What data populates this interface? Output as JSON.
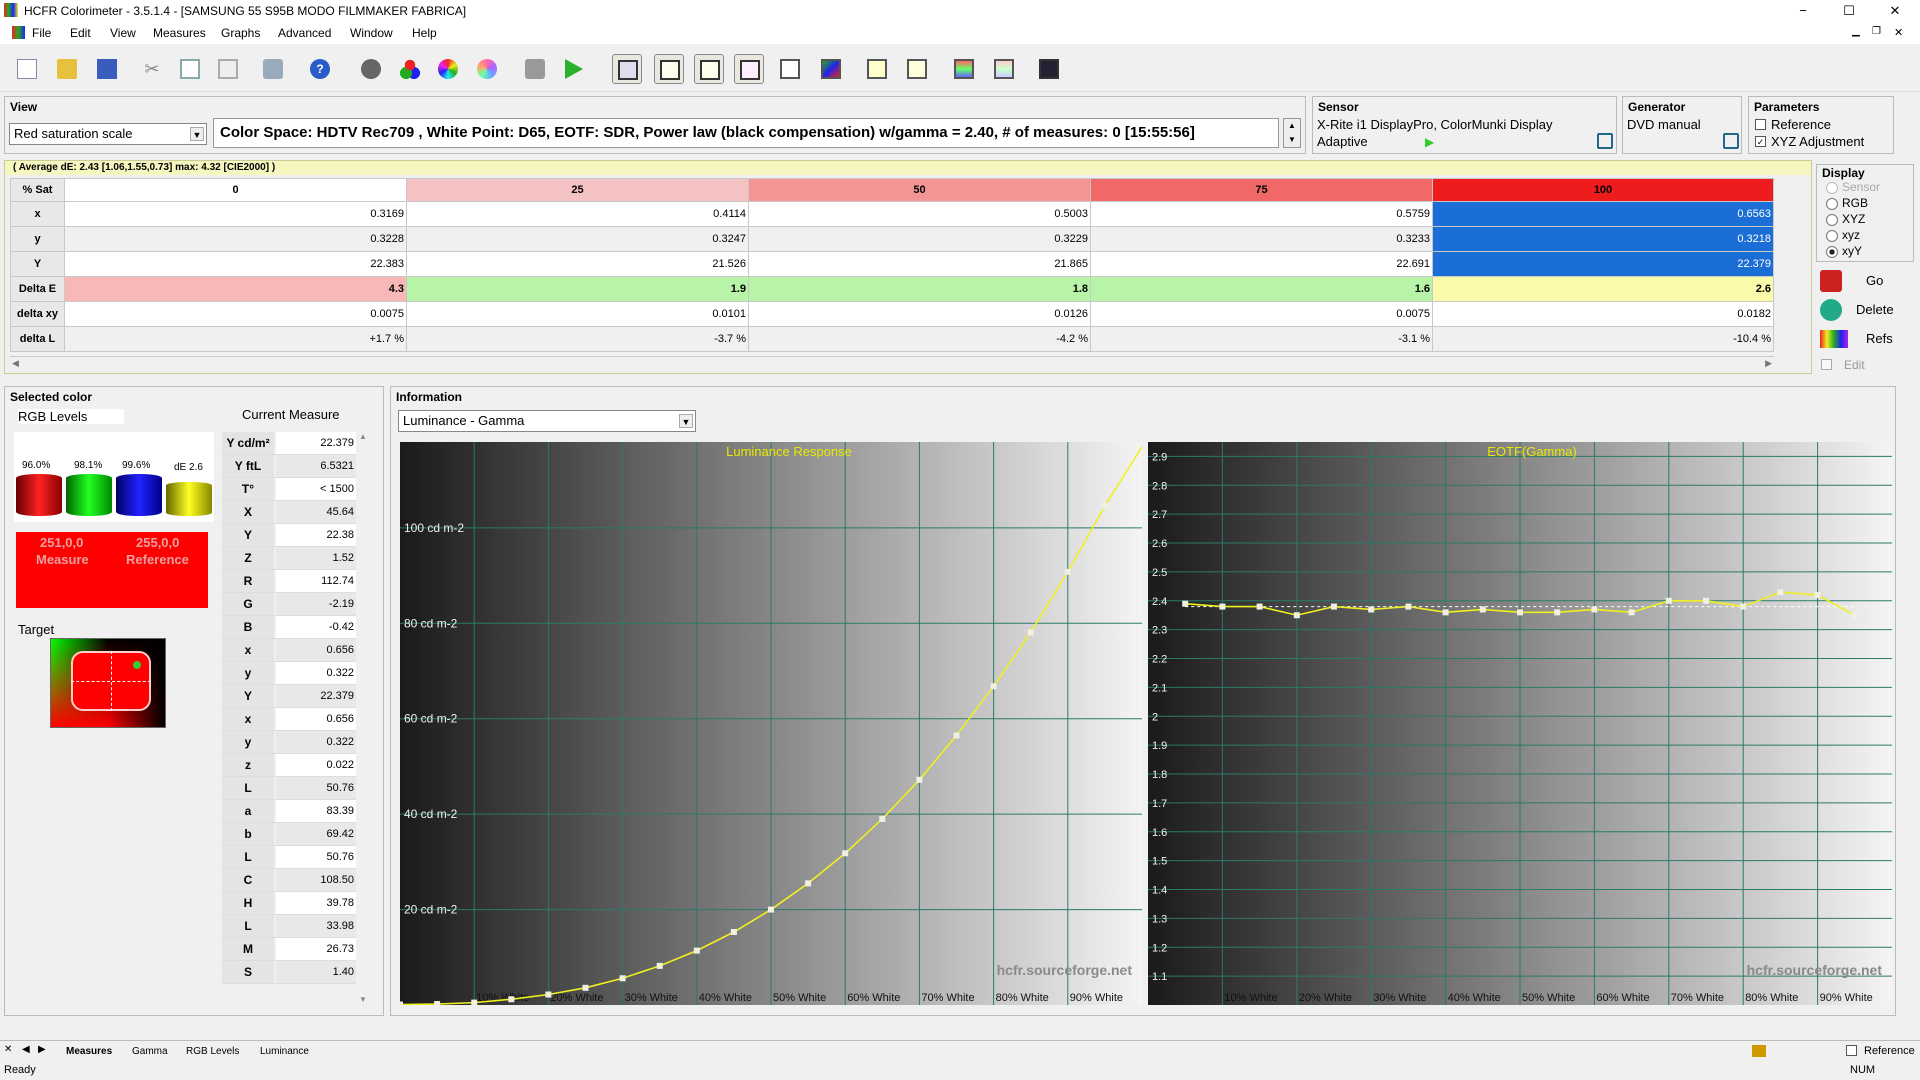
{
  "window": {
    "title": "HCFR Colorimeter - 3.5.1.4 - [SAMSUNG 55 S95B MODO FILMMAKER FABRICA]",
    "minimize": "−",
    "maximize": "☐",
    "close": "✕"
  },
  "menu": [
    "File",
    "Edit",
    "View",
    "Measures",
    "Graphs",
    "Advanced",
    "Window",
    "Help"
  ],
  "view": {
    "label": "View",
    "selected": "Red saturation scale",
    "info": "Color Space: HDTV Rec709 , White Point: D65, EOTF:  SDR, Power law (black compensation) w/gamma = 2.40, # of measures: 0 [15:55:56]"
  },
  "sensor": {
    "label": "Sensor",
    "line1": "X-Rite i1 DisplayPro, ColorMunki Display",
    "line2": "Adaptive"
  },
  "generator": {
    "label": "Generator",
    "value": "DVD manual"
  },
  "parameters": {
    "label": "Parameters",
    "reference": "Reference",
    "xyz_adjustment": "XYZ Adjustment"
  },
  "summary": "( Average dE: 2.43 [1.06,1.55,0.73] max: 4.32 [CIE2000] )",
  "table": {
    "header_label": "% Sat",
    "columns": [
      "0",
      "25",
      "50",
      "75",
      "100"
    ],
    "header_colors": [
      "#ffffff",
      "#f4c2c2",
      "#f39595",
      "#f06868",
      "#ee1c1c"
    ],
    "rows": [
      {
        "label": "x",
        "values": [
          "0.3169",
          "0.4114",
          "0.5003",
          "0.5759",
          "0.6563"
        ]
      },
      {
        "label": "y",
        "values": [
          "0.3228",
          "0.3247",
          "0.3229",
          "0.3233",
          "0.3218"
        ]
      },
      {
        "label": "Y",
        "values": [
          "22.383",
          "21.526",
          "21.865",
          "22.691",
          "22.379"
        ]
      },
      {
        "label": "Delta E",
        "values": [
          "4.3",
          "1.9",
          "1.8",
          "1.6",
          "2.6"
        ]
      },
      {
        "label": "delta xy",
        "values": [
          "0.0075",
          "0.0101",
          "0.0126",
          "0.0075",
          "0.0182"
        ]
      },
      {
        "label": "delta L",
        "values": [
          "+1.7 %",
          "-3.7 %",
          "-4.2 %",
          "-3.1 %",
          "-10.4 %"
        ]
      }
    ],
    "delta_e_colors": [
      "#f8b8b8",
      "#b8f4a8",
      "#b8f4a8",
      "#b8f4a8",
      "#fafaaa"
    ]
  },
  "display": {
    "label": "Display",
    "options": [
      "Sensor",
      "RGB",
      "XYZ",
      "xyz",
      "xyY"
    ],
    "selected": "xyY",
    "go": "Go",
    "delete": "Delete",
    "refs": "Refs",
    "edit": "Edit"
  },
  "selected_color": {
    "label": "Selected color",
    "rgb_levels": "RGB Levels",
    "current_measure": "Current Measure",
    "levels": [
      "96.0%",
      "98.1%",
      "99.6%",
      "dE 2.6"
    ],
    "measure_rgb": "251,0,0",
    "measure_label": "Measure",
    "reference_rgb": "255,0,0",
    "reference_label": "Reference",
    "target_label": "Target",
    "values": [
      {
        "k": "Y cd/m²",
        "v": "22.379"
      },
      {
        "k": "Y ftL",
        "v": "6.5321"
      },
      {
        "k": "T°",
        "v": "< 1500"
      },
      {
        "k": "X",
        "v": "45.64"
      },
      {
        "k": "Y",
        "v": "22.38"
      },
      {
        "k": "Z",
        "v": "1.52"
      },
      {
        "k": "R",
        "v": "112.74"
      },
      {
        "k": "G",
        "v": "-2.19"
      },
      {
        "k": "B",
        "v": "-0.42"
      },
      {
        "k": "x",
        "v": "0.656"
      },
      {
        "k": "y",
        "v": "0.322"
      },
      {
        "k": "Y",
        "v": "22.379"
      },
      {
        "k": "x",
        "v": "0.656"
      },
      {
        "k": "y",
        "v": "0.322"
      },
      {
        "k": "z",
        "v": "0.022"
      },
      {
        "k": "L",
        "v": "50.76"
      },
      {
        "k": "a",
        "v": "83.39"
      },
      {
        "k": "b",
        "v": "69.42"
      },
      {
        "k": "L",
        "v": "50.76"
      },
      {
        "k": "C",
        "v": "108.50"
      },
      {
        "k": "H",
        "v": "39.78"
      },
      {
        "k": "L",
        "v": "33.98"
      },
      {
        "k": "M",
        "v": "26.73"
      },
      {
        "k": "S",
        "v": "1.40"
      }
    ]
  },
  "information": {
    "label": "Information",
    "selected": "Luminance - Gamma"
  },
  "chart_data": [
    {
      "type": "line",
      "title": "Luminance Response",
      "watermark": "hcfr.sourceforge.net",
      "ytick_labels": [
        "20 cd m-2",
        "40 cd m-2",
        "60 cd m-2",
        "80 cd m-2",
        "100 cd m-2"
      ],
      "ytick_values": [
        20,
        40,
        60,
        80,
        100
      ],
      "ylim": [
        0,
        118
      ],
      "xlim": [
        0,
        100
      ],
      "xtick_labels": [
        "10% White",
        "20% White",
        "30% White",
        "40% White",
        "50% White",
        "60% White",
        "70% White",
        "80% White",
        "90% White"
      ],
      "x": [
        0,
        5,
        10,
        15,
        20,
        25,
        30,
        35,
        40,
        45,
        50,
        55,
        60,
        65,
        70,
        75,
        80,
        85,
        90,
        95
      ],
      "y": [
        0.1,
        0.2,
        0.5,
        1.2,
        2.2,
        3.6,
        5.6,
        8.2,
        11.4,
        15.3,
        20.0,
        25.5,
        31.8,
        39.0,
        47.2,
        56.5,
        66.8,
        78.1,
        90.8,
        104.6
      ]
    },
    {
      "type": "line",
      "title": "EOTF(Gamma)",
      "watermark": "hcfr.sourceforge.net",
      "ytick_labels": [
        "1.1",
        "1.2",
        "1.3",
        "1.4",
        "1.5",
        "1.6",
        "1.7",
        "1.8",
        "1.9",
        "2",
        "2.1",
        "2.2",
        "2.3",
        "2.4",
        "2.5",
        "2.6",
        "2.7",
        "2.8",
        "2.9"
      ],
      "ytick_values": [
        1.1,
        1.2,
        1.3,
        1.4,
        1.5,
        1.6,
        1.7,
        1.8,
        1.9,
        2.0,
        2.1,
        2.2,
        2.3,
        2.4,
        2.5,
        2.6,
        2.7,
        2.8,
        2.9
      ],
      "ylim": [
        1.0,
        2.95
      ],
      "xlim": [
        0,
        100
      ],
      "xtick_labels": [
        "10% White",
        "20% White",
        "30% White",
        "40% White",
        "50% White",
        "60% White",
        "70% White",
        "80% White",
        "90% White"
      ],
      "x": [
        5,
        10,
        15,
        20,
        25,
        30,
        35,
        40,
        45,
        50,
        55,
        60,
        65,
        70,
        75,
        80,
        85,
        90,
        95
      ],
      "y": [
        2.39,
        2.38,
        2.38,
        2.35,
        2.38,
        2.37,
        2.38,
        2.36,
        2.37,
        2.36,
        2.36,
        2.37,
        2.36,
        2.4,
        2.4,
        2.38,
        2.43,
        2.42,
        2.35
      ],
      "target": 2.38
    }
  ],
  "bottom_tabs": [
    "Measures",
    "Gamma",
    "RGB Levels",
    "Luminance"
  ],
  "status": {
    "left": "Ready",
    "num": "NUM",
    "reference": "Reference"
  }
}
